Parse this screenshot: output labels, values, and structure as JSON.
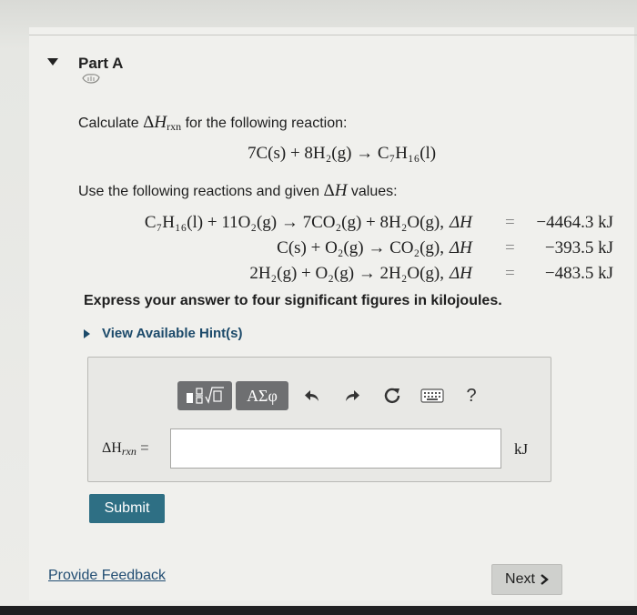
{
  "part": {
    "title": "Part A"
  },
  "question": {
    "calculate_prefix": "Calculate",
    "calculate_suffix": "for the following reaction:",
    "main_reaction": "7C(s) + 8H₂(g) → C₇H₁₆(l)",
    "use_prefix": "Use the following reactions and given",
    "use_suffix": "values:",
    "reactions": [
      {
        "equation": "C₇H₁₆(l) + 11O₂(g) → 7CO₂(g) + 8H₂O(g),",
        "value": "−4464.3 kJ"
      },
      {
        "equation": "C(s) + O₂(g) → CO₂(g),",
        "value": "−393.5 kJ"
      },
      {
        "equation": "2H₂(g) + O₂(g) → 2H₂O(g),",
        "value": "−483.5 kJ"
      }
    ],
    "delta_h": "ΔH",
    "equals": "=",
    "express": "Express your answer to four significant figures in kilojoules."
  },
  "hint": {
    "label": "View Available Hint(s)"
  },
  "toolbar": {
    "greek_label": "ΑΣφ",
    "help_label": "?"
  },
  "answer": {
    "label_delta": "ΔH",
    "label_sub": "rxn",
    "label_eq": "=",
    "value": "",
    "unit": "kJ"
  },
  "submit_label": "Submit",
  "feedback_label": "Provide Feedback",
  "next_label": "Next",
  "colors": {
    "link": "#234e73",
    "submit_bg": "#2e6f84",
    "toolbar_btn": "#6e6f71"
  }
}
